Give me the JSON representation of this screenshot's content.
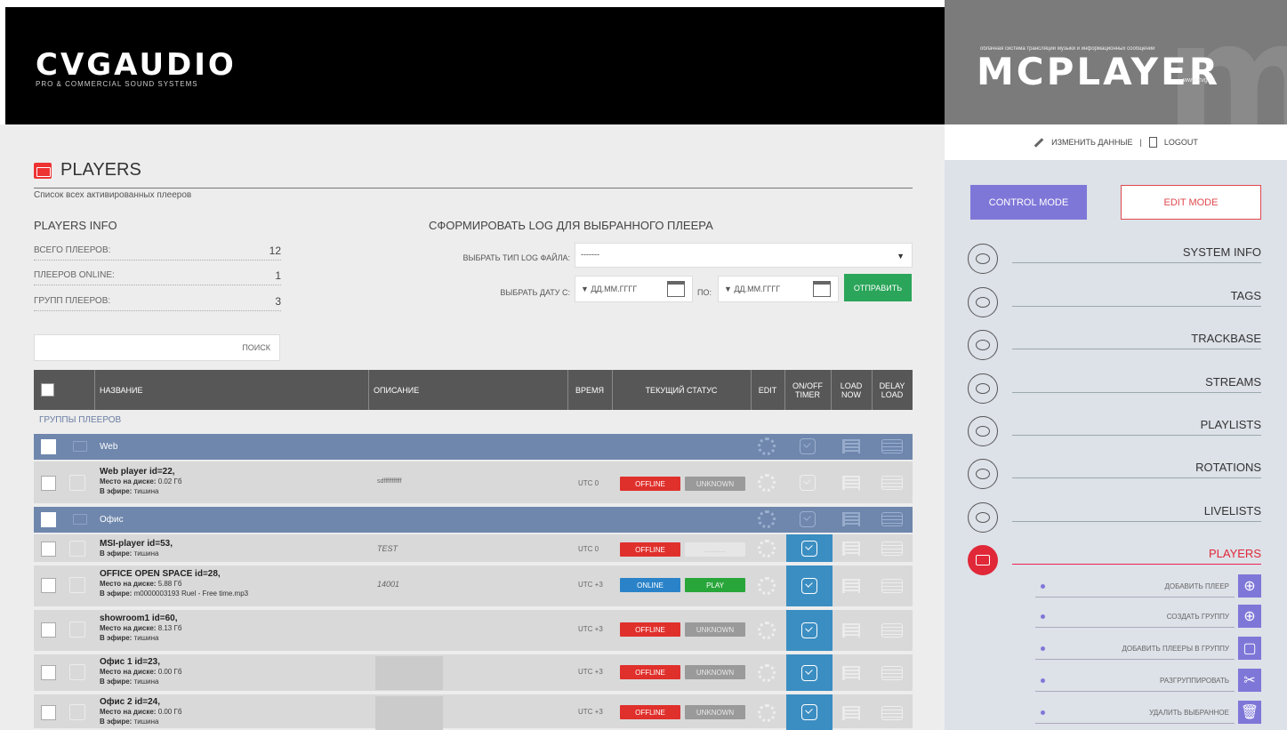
{
  "header": {
    "logo_text": "CVGAUDIO",
    "logo_sub": "PRO & COMMERCIAL SOUND SYSTEMS",
    "brand_tagline": "облачная система трансляции музыки и информационных сообщений",
    "brand_logo": "MCPLAYER",
    "brand_url": "www.cvg.ru"
  },
  "top_links": {
    "edit_data": "ИЗМЕНИТЬ ДАННЫЕ",
    "separator": "|",
    "logout": "LOGOUT"
  },
  "page": {
    "title": "PLAYERS",
    "subtitle": "Список всех активированных плееров"
  },
  "players_info": {
    "title": "PLAYERS INFO",
    "rows": [
      {
        "label": "ВСЕГО ПЛЕЕРОВ:",
        "value": "12"
      },
      {
        "label": "ПЛЕЕРОВ ONLINE:",
        "value": "1"
      },
      {
        "label": "ГРУПП ПЛЕЕРОВ:",
        "value": "3"
      }
    ]
  },
  "search": {
    "label": "ПОИСК"
  },
  "log_form": {
    "title": "СФОРМИРОВАТЬ LOG ДЛЯ ВЫБРАННОГО ПЛЕЕРА",
    "type_label": "ВЫБРАТЬ ТИП LOG ФАЙЛА:",
    "type_value": "-------",
    "type_arrow": "▼",
    "date_label": "ВЫБРАТЬ ДАТУ С:",
    "date_from": "▼ ДД.ММ.ГГГГ",
    "to_label": "ПО:",
    "date_to": "▼ ДД.ММ.ГГГГ",
    "send": "ОТПРАВИТЬ"
  },
  "table": {
    "headers": {
      "name": "НАЗВАНИЕ",
      "desc": "ОПИСАНИЕ",
      "time": "ВРЕМЯ",
      "status": "ТЕКУЩИЙ СТАТУС",
      "edit": "EDIT",
      "timer": "ON/OFF TIMER",
      "load_now": "LOAD NOW",
      "delay_load": "DELAY LOAD"
    },
    "groups_label": "ГРУППЫ ПЛЕЕРОВ",
    "group_web": "Web",
    "group_office": "Офис",
    "players": [
      {
        "name": "Web player id=22,",
        "disk": "Место на диске:",
        "disk_val": "0.02 Гб",
        "air": "В эфире:",
        "air_val": "тишина",
        "desc": "sdfffffffffff",
        "time": "UTC 0",
        "status": "OFFLINE",
        "play": "UNKNOWN"
      },
      {
        "name": "MSI-player id=53,",
        "air": "В эфире:",
        "air_val": "тишина",
        "desc": "TEST",
        "time": "UTC 0",
        "status": "OFFLINE",
        "play": "..........."
      },
      {
        "name": "OFFICE OPEN SPACE id=28,",
        "disk": "Место на диске:",
        "disk_val": "5.88 Гб",
        "air": "В эфире:",
        "air_val": "m0000003193 Ruel - Free time.mp3",
        "desc": "14001",
        "time": "UTC +3",
        "status": "ONLINE",
        "play": "PLAY"
      },
      {
        "name": "showroom1 id=60,",
        "disk": "Место на диске:",
        "disk_val": "8.13 Гб",
        "air": "В эфире:",
        "air_val": "тишина",
        "desc": "",
        "time": "UTC +3",
        "status": "OFFLINE",
        "play": "UNKNOWN"
      },
      {
        "name": "Офис 1 id=23,",
        "disk": "Место на диске:",
        "disk_val": "0.00 Гб",
        "air": "В эфире:",
        "air_val": "тишина",
        "desc": "",
        "time": "UTC +3",
        "status": "OFFLINE",
        "play": "UNKNOWN"
      },
      {
        "name": "Офис 2 id=24,",
        "disk": "Место на диске:",
        "disk_val": "0.00 Гб",
        "air": "В эфире:",
        "air_val": "тишина",
        "desc": "",
        "time": "UTC +3",
        "status": "OFFLINE",
        "play": "UNKNOWN"
      }
    ]
  },
  "sidebar": {
    "control_mode": "CONTROL MODE",
    "edit_mode": "EDIT MODE",
    "nav": [
      {
        "label": "SYSTEM INFO",
        "icon": "eye-icon"
      },
      {
        "label": "TAGS",
        "icon": "tag-icon"
      },
      {
        "label": "TRACKBASE",
        "icon": "file-music-icon"
      },
      {
        "label": "STREAMS",
        "icon": "stream-icon"
      },
      {
        "label": "PLAYLISTS",
        "icon": "list-icon"
      },
      {
        "label": "ROTATIONS",
        "icon": "layers-icon"
      },
      {
        "label": "LIVELISTS",
        "icon": "livelist-icon"
      },
      {
        "label": "PLAYERS",
        "icon": "player-icon"
      }
    ],
    "sub": [
      {
        "label": "ДОБАВИТЬ ПЛЕЕР",
        "icon": "⊕"
      },
      {
        "label": "СОЗДАТЬ ГРУППУ",
        "icon": "⊕"
      },
      {
        "label": "ДОБАВИТЬ ПЛЕЕРЫ В ГРУППУ",
        "icon": "▢"
      },
      {
        "label": "РАЗГРУППИРОВАТЬ",
        "icon": "✂"
      },
      {
        "label": "УДАЛИТЬ ВЫБРАННОЕ",
        "icon": "🗑"
      }
    ]
  },
  "colors": {
    "accent_purple": "#7f77d8",
    "active_red": "#e02838",
    "group_blue": "#6f87ad",
    "offline_red": "#e0302c",
    "online_blue": "#2a83c9",
    "play_green": "#29a63a",
    "send_green": "#2aa559"
  }
}
